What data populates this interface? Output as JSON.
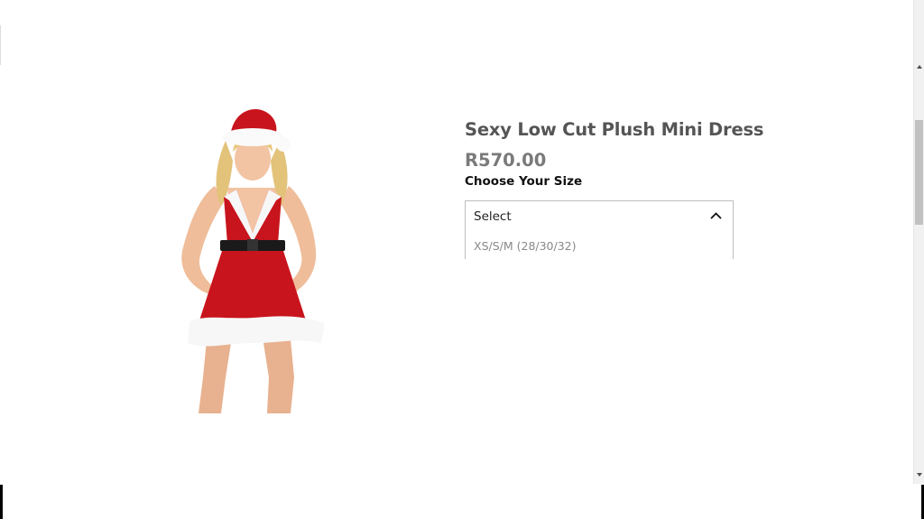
{
  "product": {
    "title": "Sexy Low Cut Plush Mini Dress",
    "price": "R570.00",
    "image_alt": "Woman in red Santa plush mini dress with white fur trim and Santa hat"
  },
  "size_selector": {
    "label": "Choose Your Size",
    "selected": "Select",
    "expanded": true,
    "options": [
      "XS/S/M (28/30/32)"
    ],
    "chevron_icon": "chevron-up-icon"
  },
  "colors": {
    "title": "#555555",
    "price": "#7a7a7a",
    "dress_red": "#c8141c",
    "fur_white": "#f7f7f7"
  }
}
